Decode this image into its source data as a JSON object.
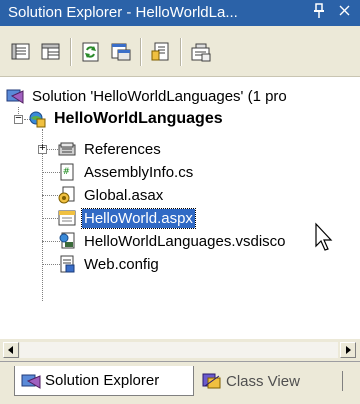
{
  "window": {
    "title": "Solution Explorer - HelloWorldLa...",
    "pin_icon": "pin-icon",
    "close_icon": "close-icon"
  },
  "toolbar": {
    "buttons": [
      {
        "name": "properties-icon"
      },
      {
        "name": "show-all-files-icon"
      },
      {
        "name": "refresh-icon"
      },
      {
        "name": "view-designer-icon"
      },
      {
        "name": "view-code-icon"
      },
      {
        "name": "copy-project-icon"
      }
    ]
  },
  "tree": {
    "solution": "Solution 'HelloWorldLanguages' (1 pro",
    "project": "HelloWorldLanguages",
    "items": [
      {
        "label": "References",
        "icon": "references-icon"
      },
      {
        "label": "AssemblyInfo.cs",
        "icon": "cs-file-icon"
      },
      {
        "label": "Global.asax",
        "icon": "global-asax-icon"
      },
      {
        "label": "HelloWorld.aspx",
        "icon": "web-form-icon",
        "selected": true
      },
      {
        "label": "HelloWorldLanguages.vsdisco",
        "icon": "vsdisco-file-icon"
      },
      {
        "label": "Web.config",
        "icon": "config-file-icon"
      }
    ]
  },
  "tabs": {
    "solution_explorer": "Solution Explorer",
    "class_view": "Class View"
  },
  "colors": {
    "titlebar": "#2b62a8",
    "selection": "#316ac5",
    "chrome": "#ece9d8"
  }
}
